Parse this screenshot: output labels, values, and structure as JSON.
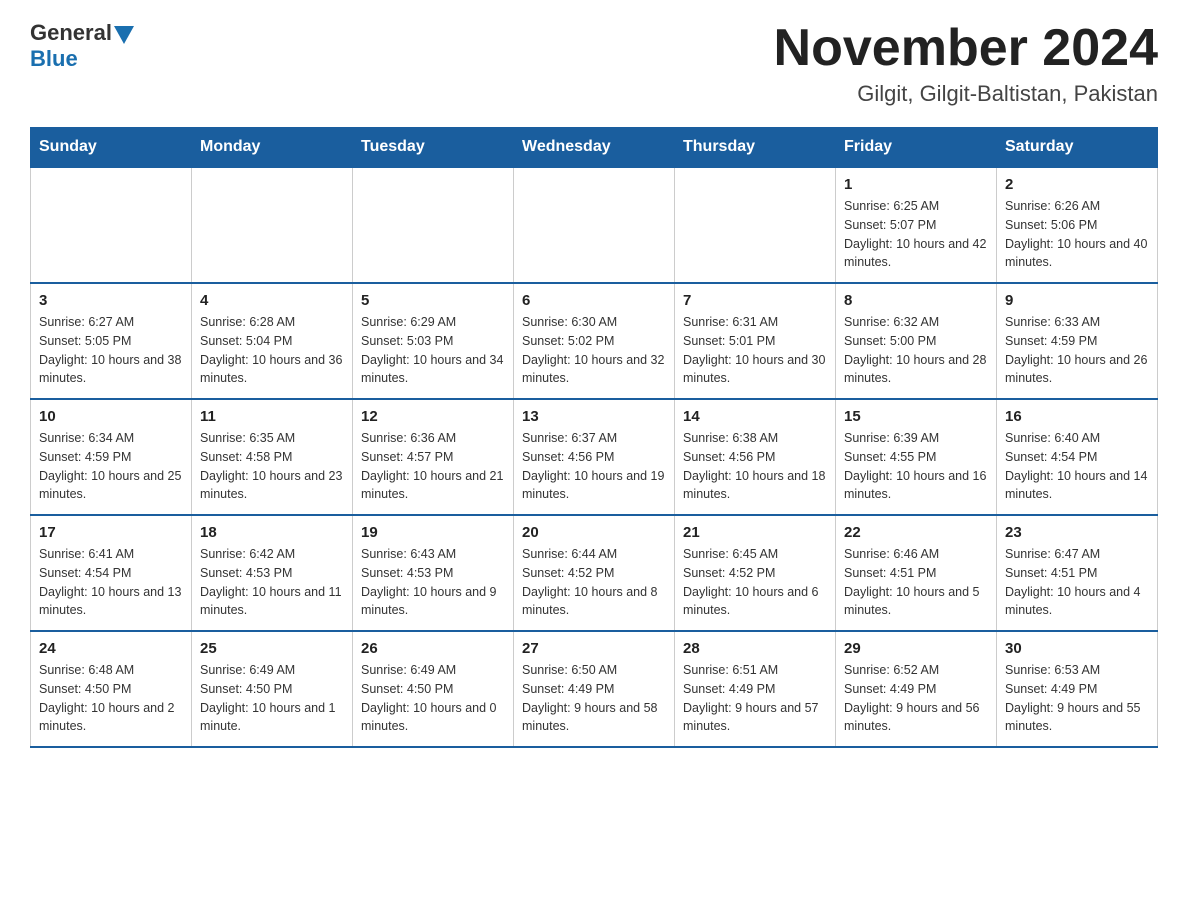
{
  "header": {
    "logo_general": "General",
    "logo_blue": "Blue",
    "month_title": "November 2024",
    "location": "Gilgit, Gilgit-Baltistan, Pakistan"
  },
  "weekdays": [
    "Sunday",
    "Monday",
    "Tuesday",
    "Wednesday",
    "Thursday",
    "Friday",
    "Saturday"
  ],
  "weeks": [
    [
      {
        "day": "",
        "info": ""
      },
      {
        "day": "",
        "info": ""
      },
      {
        "day": "",
        "info": ""
      },
      {
        "day": "",
        "info": ""
      },
      {
        "day": "",
        "info": ""
      },
      {
        "day": "1",
        "info": "Sunrise: 6:25 AM\nSunset: 5:07 PM\nDaylight: 10 hours and 42 minutes."
      },
      {
        "day": "2",
        "info": "Sunrise: 6:26 AM\nSunset: 5:06 PM\nDaylight: 10 hours and 40 minutes."
      }
    ],
    [
      {
        "day": "3",
        "info": "Sunrise: 6:27 AM\nSunset: 5:05 PM\nDaylight: 10 hours and 38 minutes."
      },
      {
        "day": "4",
        "info": "Sunrise: 6:28 AM\nSunset: 5:04 PM\nDaylight: 10 hours and 36 minutes."
      },
      {
        "day": "5",
        "info": "Sunrise: 6:29 AM\nSunset: 5:03 PM\nDaylight: 10 hours and 34 minutes."
      },
      {
        "day": "6",
        "info": "Sunrise: 6:30 AM\nSunset: 5:02 PM\nDaylight: 10 hours and 32 minutes."
      },
      {
        "day": "7",
        "info": "Sunrise: 6:31 AM\nSunset: 5:01 PM\nDaylight: 10 hours and 30 minutes."
      },
      {
        "day": "8",
        "info": "Sunrise: 6:32 AM\nSunset: 5:00 PM\nDaylight: 10 hours and 28 minutes."
      },
      {
        "day": "9",
        "info": "Sunrise: 6:33 AM\nSunset: 4:59 PM\nDaylight: 10 hours and 26 minutes."
      }
    ],
    [
      {
        "day": "10",
        "info": "Sunrise: 6:34 AM\nSunset: 4:59 PM\nDaylight: 10 hours and 25 minutes."
      },
      {
        "day": "11",
        "info": "Sunrise: 6:35 AM\nSunset: 4:58 PM\nDaylight: 10 hours and 23 minutes."
      },
      {
        "day": "12",
        "info": "Sunrise: 6:36 AM\nSunset: 4:57 PM\nDaylight: 10 hours and 21 minutes."
      },
      {
        "day": "13",
        "info": "Sunrise: 6:37 AM\nSunset: 4:56 PM\nDaylight: 10 hours and 19 minutes."
      },
      {
        "day": "14",
        "info": "Sunrise: 6:38 AM\nSunset: 4:56 PM\nDaylight: 10 hours and 18 minutes."
      },
      {
        "day": "15",
        "info": "Sunrise: 6:39 AM\nSunset: 4:55 PM\nDaylight: 10 hours and 16 minutes."
      },
      {
        "day": "16",
        "info": "Sunrise: 6:40 AM\nSunset: 4:54 PM\nDaylight: 10 hours and 14 minutes."
      }
    ],
    [
      {
        "day": "17",
        "info": "Sunrise: 6:41 AM\nSunset: 4:54 PM\nDaylight: 10 hours and 13 minutes."
      },
      {
        "day": "18",
        "info": "Sunrise: 6:42 AM\nSunset: 4:53 PM\nDaylight: 10 hours and 11 minutes."
      },
      {
        "day": "19",
        "info": "Sunrise: 6:43 AM\nSunset: 4:53 PM\nDaylight: 10 hours and 9 minutes."
      },
      {
        "day": "20",
        "info": "Sunrise: 6:44 AM\nSunset: 4:52 PM\nDaylight: 10 hours and 8 minutes."
      },
      {
        "day": "21",
        "info": "Sunrise: 6:45 AM\nSunset: 4:52 PM\nDaylight: 10 hours and 6 minutes."
      },
      {
        "day": "22",
        "info": "Sunrise: 6:46 AM\nSunset: 4:51 PM\nDaylight: 10 hours and 5 minutes."
      },
      {
        "day": "23",
        "info": "Sunrise: 6:47 AM\nSunset: 4:51 PM\nDaylight: 10 hours and 4 minutes."
      }
    ],
    [
      {
        "day": "24",
        "info": "Sunrise: 6:48 AM\nSunset: 4:50 PM\nDaylight: 10 hours and 2 minutes."
      },
      {
        "day": "25",
        "info": "Sunrise: 6:49 AM\nSunset: 4:50 PM\nDaylight: 10 hours and 1 minute."
      },
      {
        "day": "26",
        "info": "Sunrise: 6:49 AM\nSunset: 4:50 PM\nDaylight: 10 hours and 0 minutes."
      },
      {
        "day": "27",
        "info": "Sunrise: 6:50 AM\nSunset: 4:49 PM\nDaylight: 9 hours and 58 minutes."
      },
      {
        "day": "28",
        "info": "Sunrise: 6:51 AM\nSunset: 4:49 PM\nDaylight: 9 hours and 57 minutes."
      },
      {
        "day": "29",
        "info": "Sunrise: 6:52 AM\nSunset: 4:49 PM\nDaylight: 9 hours and 56 minutes."
      },
      {
        "day": "30",
        "info": "Sunrise: 6:53 AM\nSunset: 4:49 PM\nDaylight: 9 hours and 55 minutes."
      }
    ]
  ]
}
